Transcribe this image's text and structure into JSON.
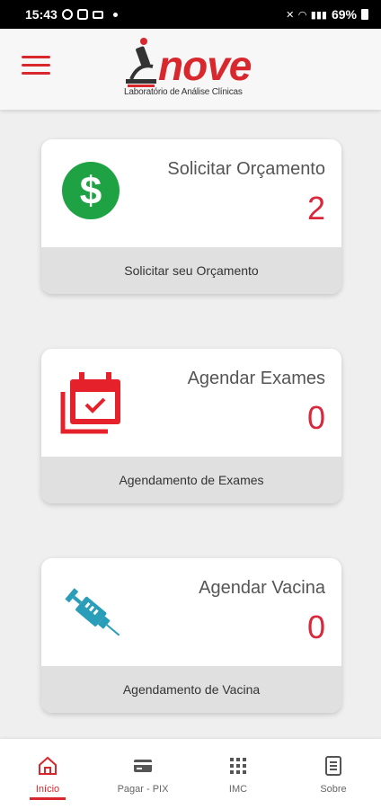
{
  "status_bar": {
    "time": "15:43",
    "battery": "69%"
  },
  "header": {
    "logo_word": "nove",
    "logo_subtitle": "Laboratório de Análise Clínicas"
  },
  "cards": [
    {
      "title": "Solicitar Orçamento",
      "count": "2",
      "footer": "Solicitar seu Orçamento",
      "icon": "dollar-icon"
    },
    {
      "title": "Agendar Exames",
      "count": "0",
      "footer": "Agendamento de Exames",
      "icon": "calendar-check-icon"
    },
    {
      "title": "Agendar Vacina",
      "count": "0",
      "footer": "Agendamento de Vacina",
      "icon": "syringe-icon"
    }
  ],
  "nav": {
    "items": [
      {
        "label": "Início",
        "icon": "home-icon",
        "active": true
      },
      {
        "label": "Pagar - PIX",
        "icon": "card-icon",
        "active": false
      },
      {
        "label": "IMC",
        "icon": "grid-icon",
        "active": false
      },
      {
        "label": "Sobre",
        "icon": "document-icon",
        "active": false
      }
    ]
  },
  "colors": {
    "brand_red": "#d9272e",
    "count_red": "#d9273b",
    "dollar_green": "#1ea243",
    "syringe_teal": "#2a9db8"
  }
}
